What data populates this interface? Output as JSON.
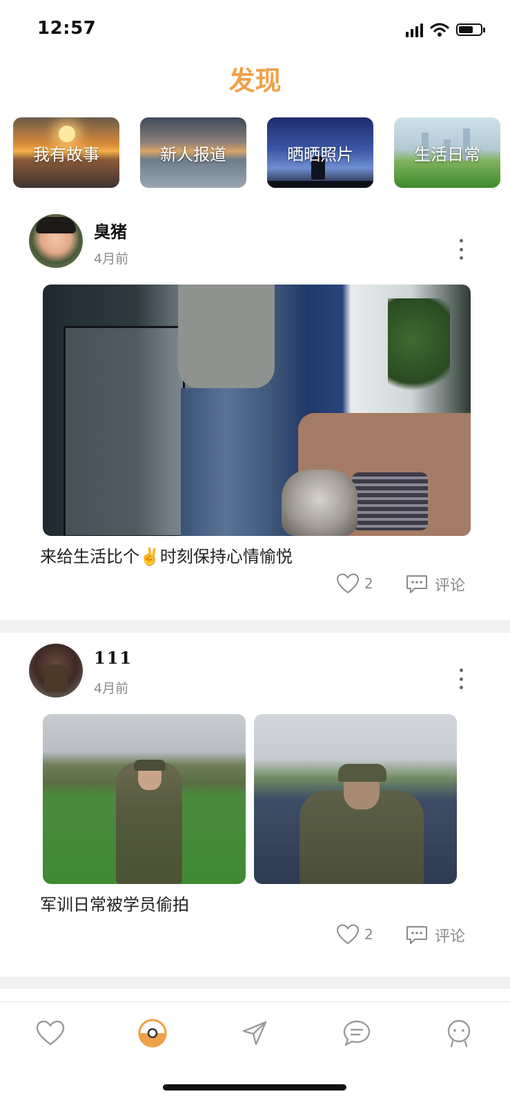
{
  "status_bar": {
    "time": "12:57"
  },
  "header": {
    "title": "发现"
  },
  "categories": [
    {
      "label": "我有故事"
    },
    {
      "label": "新人报道"
    },
    {
      "label": "晒晒照片"
    },
    {
      "label": "生活日常"
    }
  ],
  "posts": [
    {
      "author": "臭猪",
      "time": "4月前",
      "caption": "来给生活比个✌️时刻保持心情愉悦",
      "likes": "2",
      "comment_label": "评论"
    },
    {
      "author": "111",
      "time": "4月前",
      "caption": "军训日常被学员偷拍",
      "likes": "2",
      "comment_label": "评论"
    }
  ],
  "tab_bar": {
    "tabs": [
      {
        "icon": "heart-icon"
      },
      {
        "icon": "discover-icon",
        "active": true
      },
      {
        "icon": "send-icon"
      },
      {
        "icon": "chat-icon"
      },
      {
        "icon": "profile-icon"
      }
    ],
    "active_color": "#f0a24a"
  },
  "colors": {
    "accent": "#f0a24a",
    "muted": "#8a8a8a"
  }
}
